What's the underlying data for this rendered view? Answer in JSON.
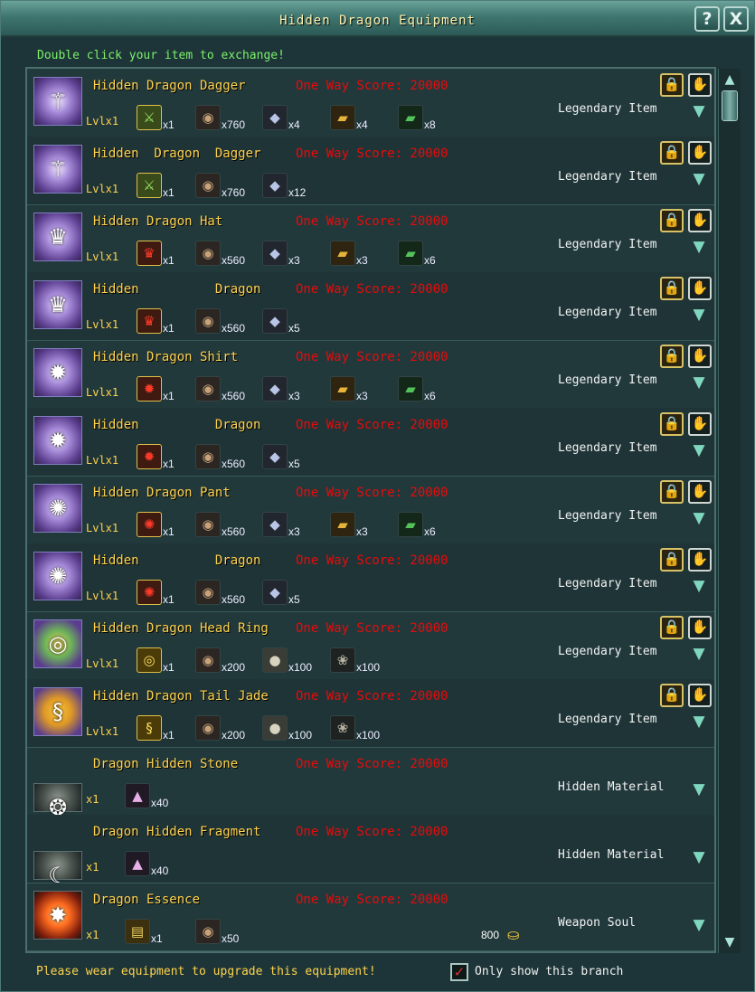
{
  "window": {
    "title": "Hidden Dragon Equipment",
    "help_label": "?",
    "close_label": "X"
  },
  "instruction": "Double click your item to exchange!",
  "footer": {
    "note": "Please wear equipment to upgrade this equipment!",
    "checkbox_label": "Only show this branch",
    "checkbox_checked": true
  },
  "items": [
    {
      "name": "Hidden Dragon Dagger",
      "score": "One Way Score: 20000",
      "type": "Legendary Item",
      "level": "Lvlx1",
      "thumb": "dagger-icon",
      "thumb_glyph": "⚚",
      "locked": true,
      "materials": [
        {
          "icon": "dagger-icon",
          "qty": "x1",
          "cls": "ic-sword",
          "glyph": "⚔"
        },
        {
          "icon": "ore-icon",
          "qty": "x760",
          "cls": "ic-ore",
          "glyph": "◉"
        },
        {
          "icon": "crystal-icon",
          "qty": "x4",
          "cls": "ic-crystal",
          "glyph": "◆"
        },
        {
          "icon": "gold-bar-icon",
          "qty": "x4",
          "cls": "ic-gold",
          "glyph": "▰"
        },
        {
          "icon": "jade-bar-icon",
          "qty": "x8",
          "cls": "ic-jade",
          "glyph": "▰"
        }
      ]
    },
    {
      "name": "Hidden  Dragon  Dagger",
      "score": "One Way Score: 20000",
      "type": "Legendary Item",
      "level": "Lvlx1",
      "thumb": "dagger-icon",
      "thumb_glyph": "⚚",
      "locked": true,
      "materials": [
        {
          "icon": "dagger-icon",
          "qty": "x1",
          "cls": "ic-sword",
          "glyph": "⚔"
        },
        {
          "icon": "ore-icon",
          "qty": "x760",
          "cls": "ic-ore",
          "glyph": "◉"
        },
        {
          "icon": "crystal-icon",
          "qty": "x12",
          "cls": "ic-crystal",
          "glyph": "◆"
        }
      ]
    },
    {
      "name": "Hidden Dragon Hat",
      "score": "One Way Score: 20000",
      "type": "Legendary Item",
      "level": "Lvlx1",
      "thumb": "hat-icon",
      "thumb_glyph": "♛",
      "locked": true,
      "materials": [
        {
          "icon": "hat-icon",
          "qty": "x1",
          "cls": "ic-hat",
          "glyph": "♛"
        },
        {
          "icon": "ore-icon",
          "qty": "x560",
          "cls": "ic-ore",
          "glyph": "◉"
        },
        {
          "icon": "crystal-icon",
          "qty": "x3",
          "cls": "ic-crystal",
          "glyph": "◆"
        },
        {
          "icon": "gold-bar-icon",
          "qty": "x3",
          "cls": "ic-gold",
          "glyph": "▰"
        },
        {
          "icon": "jade-bar-icon",
          "qty": "x6",
          "cls": "ic-jade",
          "glyph": "▰"
        }
      ]
    },
    {
      "name": "Hidden          Dragon",
      "score": "One Way Score: 20000",
      "type": "Legendary Item",
      "level": "Lvlx1",
      "thumb": "hat-icon",
      "thumb_glyph": "♛",
      "locked": true,
      "materials": [
        {
          "icon": "hat-icon",
          "qty": "x1",
          "cls": "ic-hat",
          "glyph": "♛"
        },
        {
          "icon": "ore-icon",
          "qty": "x560",
          "cls": "ic-ore",
          "glyph": "◉"
        },
        {
          "icon": "crystal-icon",
          "qty": "x5",
          "cls": "ic-crystal",
          "glyph": "◆"
        }
      ]
    },
    {
      "name": "Hidden Dragon Shirt",
      "score": "One Way Score: 20000",
      "type": "Legendary Item",
      "level": "Lvlx1",
      "thumb": "shirt-icon",
      "thumb_glyph": "✹",
      "locked": true,
      "materials": [
        {
          "icon": "shirt-icon",
          "qty": "x1",
          "cls": "ic-hat",
          "glyph": "✹"
        },
        {
          "icon": "ore-icon",
          "qty": "x560",
          "cls": "ic-ore",
          "glyph": "◉"
        },
        {
          "icon": "crystal-icon",
          "qty": "x3",
          "cls": "ic-crystal",
          "glyph": "◆"
        },
        {
          "icon": "gold-bar-icon",
          "qty": "x3",
          "cls": "ic-gold",
          "glyph": "▰"
        },
        {
          "icon": "jade-bar-icon",
          "qty": "x6",
          "cls": "ic-jade",
          "glyph": "▰"
        }
      ]
    },
    {
      "name": "Hidden          Dragon",
      "score": "One Way Score: 20000",
      "type": "Legendary Item",
      "level": "Lvlx1",
      "thumb": "shirt-icon",
      "thumb_glyph": "✹",
      "locked": true,
      "materials": [
        {
          "icon": "shirt-icon",
          "qty": "x1",
          "cls": "ic-hat",
          "glyph": "✹"
        },
        {
          "icon": "ore-icon",
          "qty": "x560",
          "cls": "ic-ore",
          "glyph": "◉"
        },
        {
          "icon": "crystal-icon",
          "qty": "x5",
          "cls": "ic-crystal",
          "glyph": "◆"
        }
      ]
    },
    {
      "name": "Hidden Dragon Pant",
      "score": "One Way Score: 20000",
      "type": "Legendary Item",
      "level": "Lvlx1",
      "thumb": "pant-icon",
      "thumb_glyph": "✺",
      "locked": true,
      "materials": [
        {
          "icon": "pant-icon",
          "qty": "x1",
          "cls": "ic-hat",
          "glyph": "✺"
        },
        {
          "icon": "ore-icon",
          "qty": "x560",
          "cls": "ic-ore",
          "glyph": "◉"
        },
        {
          "icon": "crystal-icon",
          "qty": "x3",
          "cls": "ic-crystal",
          "glyph": "◆"
        },
        {
          "icon": "gold-bar-icon",
          "qty": "x3",
          "cls": "ic-gold",
          "glyph": "▰"
        },
        {
          "icon": "jade-bar-icon",
          "qty": "x6",
          "cls": "ic-jade",
          "glyph": "▰"
        }
      ]
    },
    {
      "name": "Hidden          Dragon",
      "score": "One Way Score: 20000",
      "type": "Legendary Item",
      "level": "Lvlx1",
      "thumb": "pant-icon",
      "thumb_glyph": "✺",
      "locked": true,
      "materials": [
        {
          "icon": "pant-icon",
          "qty": "x1",
          "cls": "ic-hat",
          "glyph": "✺"
        },
        {
          "icon": "ore-icon",
          "qty": "x560",
          "cls": "ic-ore",
          "glyph": "◉"
        },
        {
          "icon": "crystal-icon",
          "qty": "x5",
          "cls": "ic-crystal",
          "glyph": "◆"
        }
      ]
    },
    {
      "name": "Hidden Dragon Head Ring",
      "score": "One Way Score: 20000",
      "type": "Legendary Item",
      "level": "Lvlx1",
      "thumb": "ring-icon",
      "thumb_glyph": "◎",
      "locked": true,
      "materials": [
        {
          "icon": "ring-icon",
          "qty": "x1",
          "cls": "ic-ring",
          "glyph": "◎"
        },
        {
          "icon": "ore-icon",
          "qty": "x200",
          "cls": "ic-ore",
          "glyph": "◉"
        },
        {
          "icon": "coin-icon",
          "qty": "x100",
          "cls": "ic-coin",
          "glyph": "●"
        },
        {
          "icon": "dragon-stone-icon",
          "qty": "x100",
          "cls": "ic-dragon",
          "glyph": "❀"
        }
      ]
    },
    {
      "name": "Hidden Dragon Tail Jade",
      "score": "One Way Score: 20000",
      "type": "Legendary Item",
      "level": "Lvlx1",
      "thumb": "jade-icon",
      "thumb_glyph": "§",
      "locked": true,
      "materials": [
        {
          "icon": "jade-icon",
          "qty": "x1",
          "cls": "ic-ring",
          "glyph": "§"
        },
        {
          "icon": "ore-icon",
          "qty": "x200",
          "cls": "ic-ore",
          "glyph": "◉"
        },
        {
          "icon": "coin-icon",
          "qty": "x100",
          "cls": "ic-coin",
          "glyph": "●"
        },
        {
          "icon": "dragon-stone-icon",
          "qty": "x100",
          "cls": "ic-dragon",
          "glyph": "❀"
        }
      ]
    },
    {
      "name": "Dragon Hidden Stone",
      "score": "One Way Score: 20000",
      "type": "Hidden Material",
      "level": "x1",
      "thumb": "dragon-stone-icon",
      "thumb_glyph": "❂",
      "locked": false,
      "materials": [
        {
          "icon": "gem-icon",
          "qty": "x40",
          "cls": "ic-gem",
          "glyph": "▲"
        }
      ]
    },
    {
      "name": "Dragon Hidden Fragment",
      "score": "One Way Score: 20000",
      "type": "Hidden Material",
      "level": "x1",
      "thumb": "dragon-fragment-icon",
      "thumb_glyph": "☾",
      "locked": false,
      "materials": [
        {
          "icon": "gem-icon",
          "qty": "x40",
          "cls": "ic-gem",
          "glyph": "▲"
        }
      ]
    },
    {
      "name": "Dragon Essence",
      "score": "One Way Score: 20000",
      "type": "Weapon Soul",
      "level": "x1",
      "thumb": "essence-icon",
      "thumb_glyph": "✸",
      "locked": false,
      "price": "800",
      "materials": [
        {
          "icon": "gold-scroll-icon",
          "qty": "x1",
          "cls": "ic-gold2",
          "glyph": "▤"
        },
        {
          "icon": "ore-icon",
          "qty": "x50",
          "cls": "ic-ore",
          "glyph": "◉"
        }
      ]
    }
  ]
}
